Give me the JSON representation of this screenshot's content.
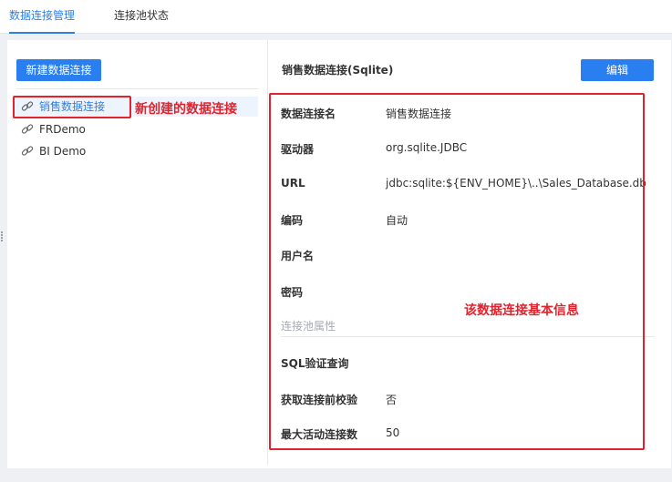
{
  "tabs": [
    {
      "label": "数据连接管理",
      "active": true
    },
    {
      "label": "连接池状态",
      "active": false
    }
  ],
  "left_panel": {
    "new_button": "新建数据连接",
    "connections": [
      {
        "name": "销售数据连接",
        "icon": "link-icon",
        "selected": true
      },
      {
        "name": "FRDemo",
        "icon": "link-icon",
        "selected": false
      },
      {
        "name": "BI Demo",
        "icon": "link-icon",
        "selected": false
      }
    ],
    "annotation": "新创建的数据连接"
  },
  "detail": {
    "title": "销售数据连接(Sqlite)",
    "edit_button": "编辑",
    "fields": [
      {
        "label": "数据连接名",
        "value": "销售数据连接"
      },
      {
        "label": "驱动器",
        "value": "org.sqlite.JDBC"
      },
      {
        "label": "URL",
        "value": "jdbc:sqlite:${ENV_HOME}\\..\\Sales_Database.db"
      },
      {
        "label": "编码",
        "value": "自动"
      },
      {
        "label": "用户名",
        "value": ""
      },
      {
        "label": "密码",
        "value": ""
      }
    ],
    "pool_section_label": "连接池属性",
    "pool_fields": [
      {
        "label": "SQL验证查询",
        "value": ""
      },
      {
        "label": "获取连接前校验",
        "value": "否"
      },
      {
        "label": "最大活动连接数",
        "value": "50"
      }
    ],
    "annotation": "该数据连接基本信息"
  },
  "colors": {
    "accent": "#2a7ff0",
    "annotation_red": "#e0232d",
    "muted_text": "#a7abb2"
  }
}
